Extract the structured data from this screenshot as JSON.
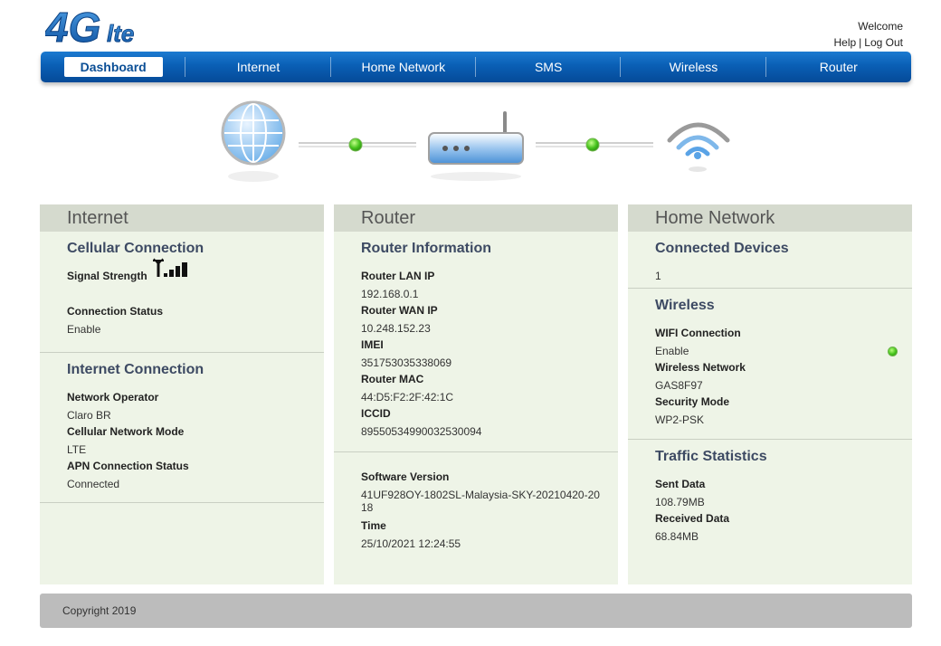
{
  "header": {
    "logo_text": "4Glte",
    "welcome": "Welcome",
    "help": "Help",
    "separator": "|",
    "logout": "Log Out"
  },
  "nav": {
    "items": [
      "Dashboard",
      "Internet",
      "Home Network",
      "SMS",
      "Wireless",
      "Router"
    ],
    "active": "Dashboard"
  },
  "panels": {
    "internet": {
      "title": "Internet",
      "cellular": {
        "title": "Cellular Connection",
        "signal_label": "Signal Strength",
        "status_label": "Connection Status",
        "status_value": "Enable"
      },
      "connection": {
        "title": "Internet Connection",
        "operator_label": "Network Operator",
        "operator_value": "Claro BR",
        "mode_label": "Cellular Network Mode",
        "mode_value": "LTE",
        "apn_label": "APN Connection Status",
        "apn_value": "Connected"
      }
    },
    "router": {
      "title": "Router",
      "info": {
        "title": "Router Information",
        "lan_label": "Router LAN IP",
        "lan_value": "192.168.0.1",
        "wan_label": "Router WAN IP",
        "wan_value": "10.248.152.23",
        "imei_label": "IMEI",
        "imei_value": "351753035338069",
        "mac_label": "Router MAC",
        "mac_value": "44:D5:F2:2F:42:1C",
        "iccid_label": "ICCID",
        "iccid_value": "89550534990032530094"
      },
      "software": {
        "version_label": "Software Version",
        "version_value": "41UF928OY-1802SL-Malaysia-SKY-20210420-2018",
        "time_label": "Time",
        "time_value": "25/10/2021 12:24:55"
      }
    },
    "home": {
      "title": "Home Network",
      "devices": {
        "title": "Connected Devices",
        "value": "1"
      },
      "wireless": {
        "title": "Wireless",
        "wifi_label": "WIFI Connection",
        "wifi_value": "Enable",
        "network_label": "Wireless Network",
        "network_value": "GAS8F97",
        "security_label": "Security Mode",
        "security_value": "WP2-PSK"
      },
      "traffic": {
        "title": "Traffic Statistics",
        "sent_label": "Sent Data",
        "sent_value": "108.79MB",
        "received_label": "Received Data",
        "received_value": "68.84MB"
      }
    }
  },
  "footer": {
    "copyright": "Copyright 2019"
  },
  "colors": {
    "nav_blue": "#0a5fb5",
    "panel_bg": "#eef4e7",
    "panel_head": "#d5dace",
    "status_green": "#45c21c",
    "section_title": "#3d4a63"
  },
  "icons": [
    "globe-icon",
    "router-icon",
    "wifi-icon",
    "signal-strength-icon",
    "status-dot-icon"
  ]
}
